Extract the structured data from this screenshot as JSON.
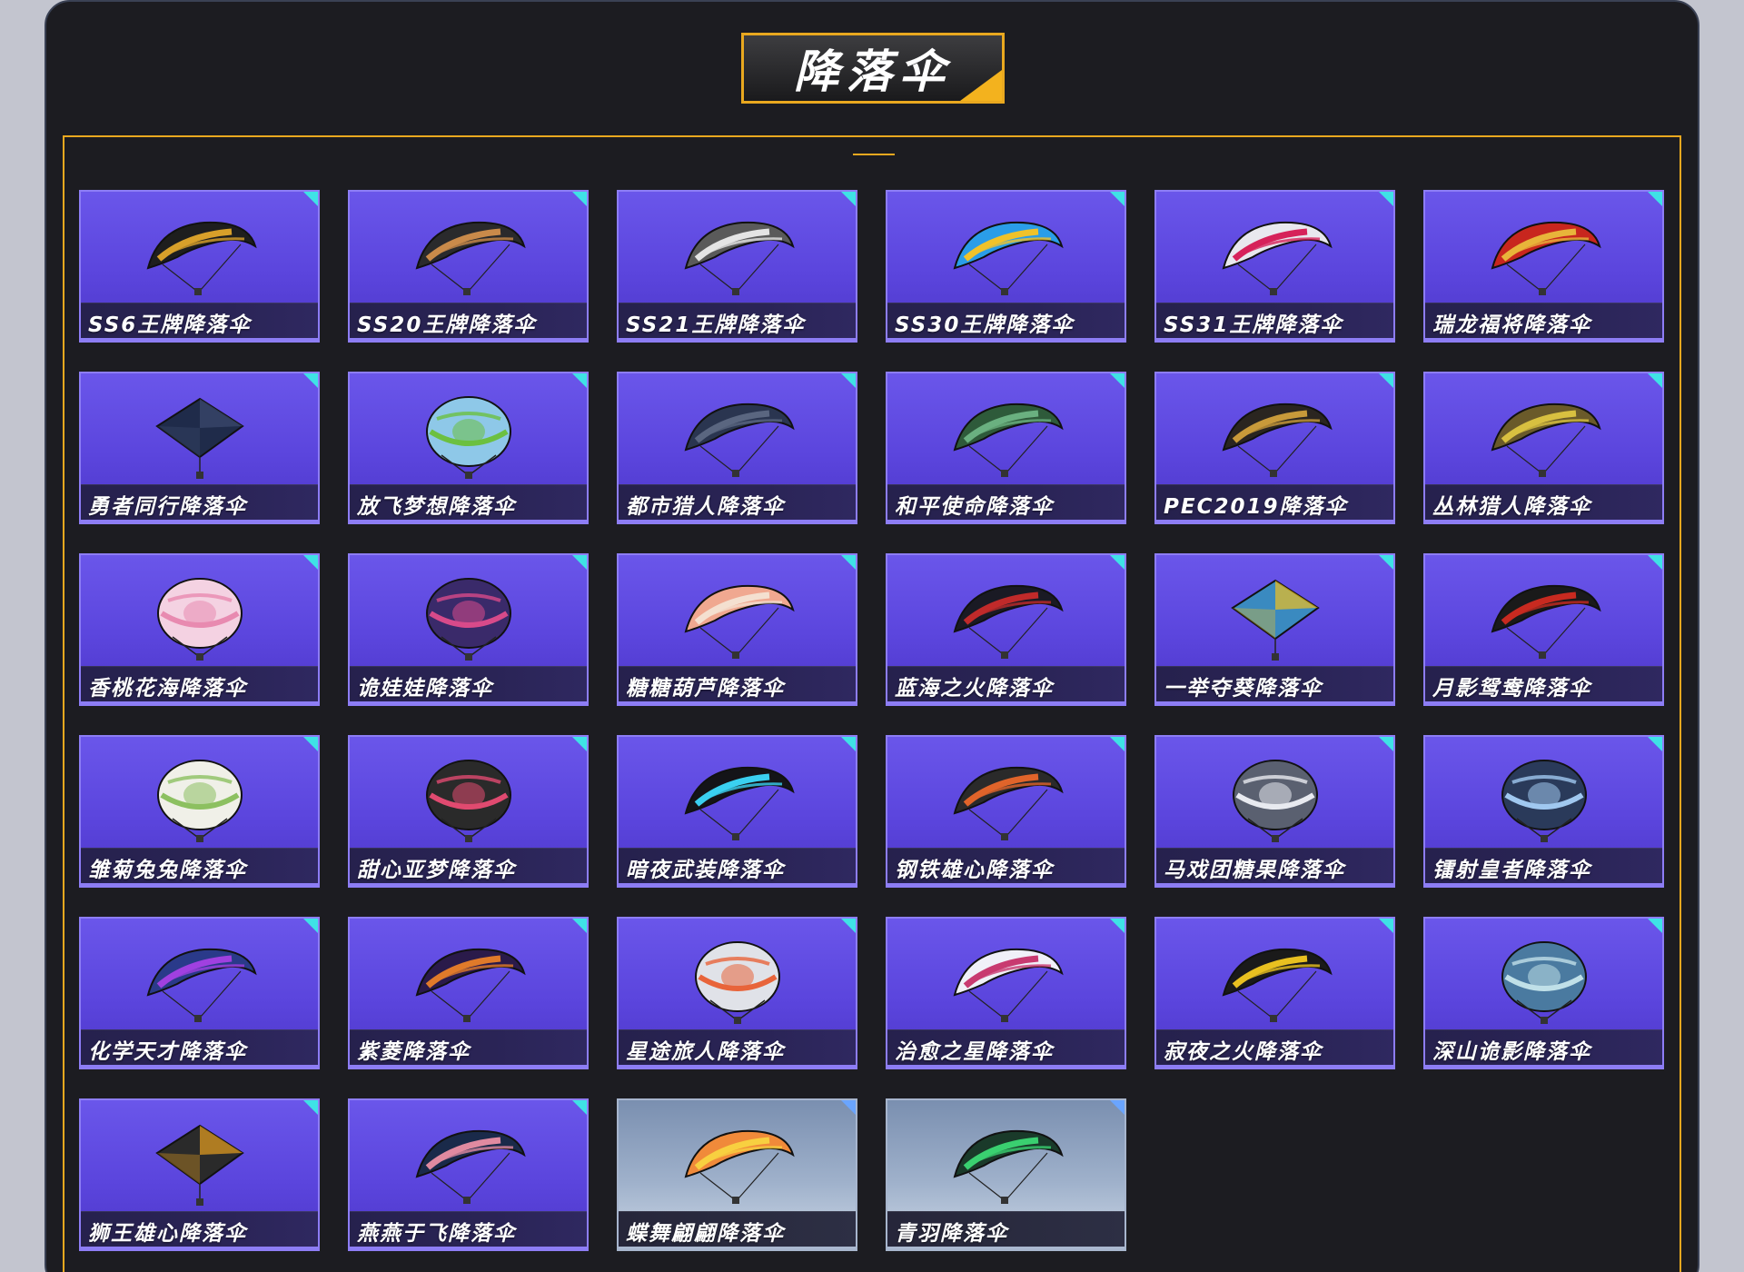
{
  "header": {
    "title": "降落伞"
  },
  "colors": {
    "accent": "#e9a81f",
    "card_bg": "#5b45dd",
    "corner_tag": "#3fe2e6"
  },
  "items": [
    {
      "label": "SS6王牌降落伞",
      "icon": "parachute-icon",
      "colors": [
        "#1e1e1e",
        "#d8a02a"
      ],
      "shape": "wing"
    },
    {
      "label": "SS20王牌降落伞",
      "icon": "parachute-icon",
      "colors": [
        "#2a2a2c",
        "#c98a4a"
      ],
      "shape": "wing"
    },
    {
      "label": "SS21王牌降落伞",
      "icon": "parachute-icon",
      "colors": [
        "#5a5a5a",
        "#e4e4e4"
      ],
      "shape": "wing"
    },
    {
      "label": "SS30王牌降落伞",
      "icon": "parachute-icon",
      "colors": [
        "#2a9de8",
        "#f0c22a"
      ],
      "shape": "wing"
    },
    {
      "label": "SS31王牌降落伞",
      "icon": "parachute-icon",
      "colors": [
        "#e8e8ee",
        "#d6225a"
      ],
      "shape": "wing"
    },
    {
      "label": "瑞龙福将降落伞",
      "icon": "parachute-icon",
      "colors": [
        "#c8261e",
        "#e8b43a"
      ],
      "shape": "wing"
    },
    {
      "label": "勇者同行降落伞",
      "icon": "parachute-icon",
      "colors": [
        "#1f2b4a",
        "#3c4a6e"
      ],
      "shape": "square"
    },
    {
      "label": "放飞梦想降落伞",
      "icon": "parachute-icon",
      "colors": [
        "#8ec8e8",
        "#6cc040"
      ],
      "shape": "round"
    },
    {
      "label": "都市猎人降落伞",
      "icon": "parachute-icon",
      "colors": [
        "#2a3550",
        "#5a6680"
      ],
      "shape": "wing"
    },
    {
      "label": "和平使命降落伞",
      "icon": "parachute-icon",
      "colors": [
        "#2e5a3a",
        "#6ab080"
      ],
      "shape": "wing"
    },
    {
      "label": "PEC2019降落伞",
      "icon": "parachute-icon",
      "colors": [
        "#2a2520",
        "#c89a3a"
      ],
      "shape": "wing"
    },
    {
      "label": "丛林猎人降落伞",
      "icon": "parachute-icon",
      "colors": [
        "#6a5a2a",
        "#d8c040"
      ],
      "shape": "wing"
    },
    {
      "label": "香桃花海降落伞",
      "icon": "parachute-icon",
      "colors": [
        "#f4d2e2",
        "#e88ab0"
      ],
      "shape": "round"
    },
    {
      "label": "诡娃娃降落伞",
      "icon": "parachute-icon",
      "colors": [
        "#3a2a6a",
        "#d84a8a"
      ],
      "shape": "round"
    },
    {
      "label": "糖糖葫芦降落伞",
      "icon": "parachute-icon",
      "colors": [
        "#f0a890",
        "#f4e0d0"
      ],
      "shape": "wing"
    },
    {
      "label": "蓝海之火降落伞",
      "icon": "parachute-icon",
      "colors": [
        "#1a1a24",
        "#c02a2a"
      ],
      "shape": "wing"
    },
    {
      "label": "一举夺葵降落伞",
      "icon": "parachute-icon",
      "colors": [
        "#3a8ac0",
        "#f0c020"
      ],
      "shape": "square"
    },
    {
      "label": "月影鸳鸯降落伞",
      "icon": "parachute-icon",
      "colors": [
        "#1a1a1a",
        "#c82a20"
      ],
      "shape": "wing"
    },
    {
      "label": "雏菊兔兔降落伞",
      "icon": "parachute-icon",
      "colors": [
        "#f0f0e8",
        "#8cc060"
      ],
      "shape": "round"
    },
    {
      "label": "甜心亚梦降落伞",
      "icon": "parachute-icon",
      "colors": [
        "#2a2a2a",
        "#e04a70"
      ],
      "shape": "round"
    },
    {
      "label": "暗夜武装降落伞",
      "icon": "parachute-icon",
      "colors": [
        "#141418",
        "#3ad0f0"
      ],
      "shape": "wing"
    },
    {
      "label": "钢铁雄心降落伞",
      "icon": "parachute-icon",
      "colors": [
        "#2a2a2a",
        "#e0642a"
      ],
      "shape": "wing"
    },
    {
      "label": "马戏团糖果降落伞",
      "icon": "parachute-icon",
      "colors": [
        "#5a6070",
        "#e8eaf0"
      ],
      "shape": "round"
    },
    {
      "label": "镭射皇者降落伞",
      "icon": "parachute-icon",
      "colors": [
        "#2a3a5a",
        "#a0c8f0"
      ],
      "shape": "round"
    },
    {
      "label": "化学天才降落伞",
      "icon": "parachute-icon",
      "colors": [
        "#2a3a8a",
        "#a040e0"
      ],
      "shape": "wing"
    },
    {
      "label": "紫菱降落伞",
      "icon": "parachute-icon",
      "colors": [
        "#2a1a4a",
        "#e07a2a"
      ],
      "shape": "wing"
    },
    {
      "label": "星途旅人降落伞",
      "icon": "parachute-icon",
      "colors": [
        "#e0e2e8",
        "#e8643a"
      ],
      "shape": "round"
    },
    {
      "label": "治愈之星降落伞",
      "icon": "parachute-icon",
      "colors": [
        "#f0f0f8",
        "#c83a70"
      ],
      "shape": "wing"
    },
    {
      "label": "寂夜之火降落伞",
      "icon": "parachute-icon",
      "colors": [
        "#1a1a1a",
        "#e8c020"
      ],
      "shape": "wing"
    },
    {
      "label": "深山诡影降落伞",
      "icon": "parachute-icon",
      "colors": [
        "#4a7aa0",
        "#c0e0e8"
      ],
      "shape": "round"
    },
    {
      "label": "狮王雄心降落伞",
      "icon": "parachute-icon",
      "colors": [
        "#2a2a2a",
        "#e8a020"
      ],
      "shape": "square"
    },
    {
      "label": "燕燕于飞降落伞",
      "icon": "parachute-icon",
      "colors": [
        "#1a2a4a",
        "#e08aa0"
      ],
      "shape": "wing"
    },
    {
      "label": "蝶舞翩翩降落伞",
      "icon": "parachute-icon",
      "colors": [
        "#f08a3a",
        "#f8d040"
      ],
      "shape": "wing",
      "special": true
    },
    {
      "label": "青羽降落伞",
      "icon": "parachute-icon",
      "colors": [
        "#1a3a2a",
        "#3ad070"
      ],
      "shape": "wing",
      "special": true
    }
  ]
}
